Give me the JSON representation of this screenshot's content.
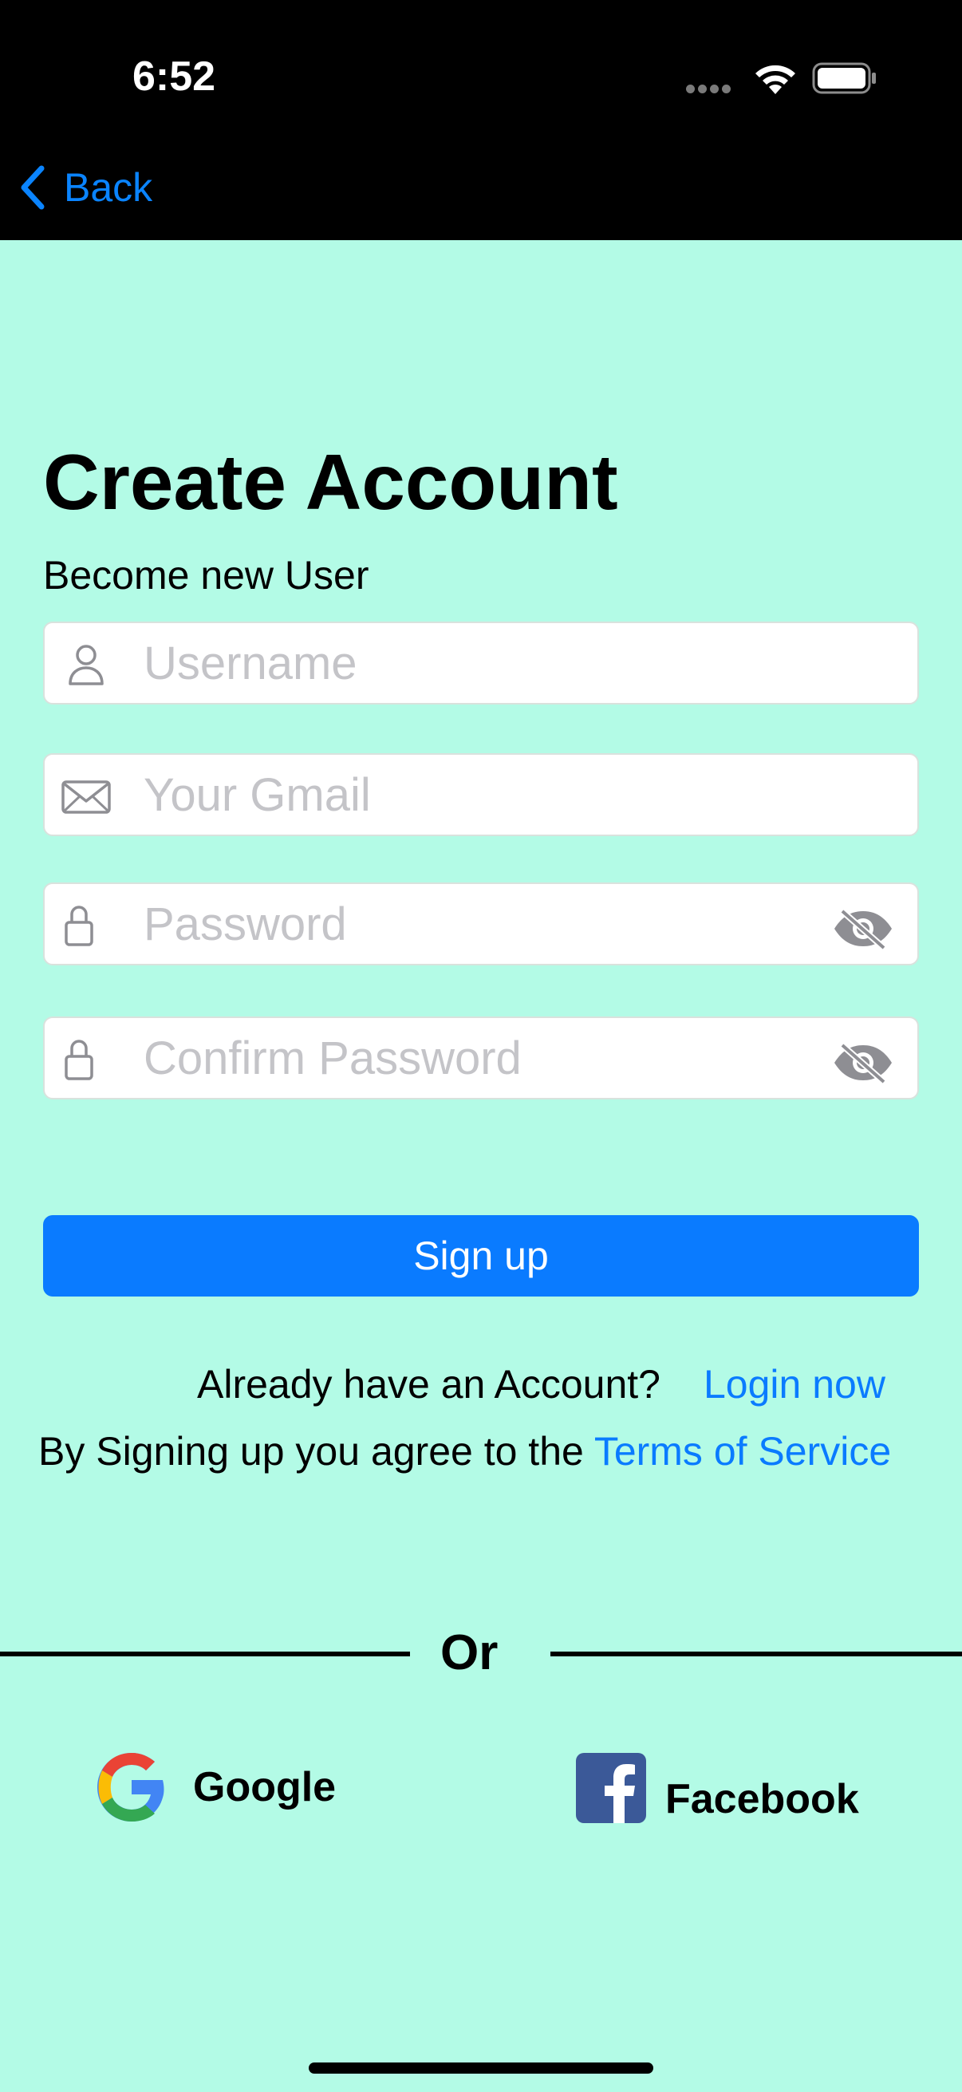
{
  "status_bar": {
    "time": "6:52",
    "icons": [
      "signal-icon",
      "wifi-icon",
      "battery-icon"
    ]
  },
  "nav": {
    "back_label": "Back",
    "back_icon": "chevron-left-icon",
    "accent_color": "#0a84ff"
  },
  "form": {
    "title": "Create Account",
    "subtitle": "Become new User",
    "fields": [
      {
        "placeholder": "Username",
        "value": "",
        "icon": "person-icon"
      },
      {
        "placeholder": "Your Gmail",
        "value": "",
        "icon": "envelope-icon"
      },
      {
        "placeholder": "Password",
        "value": "",
        "icon": "lock-icon",
        "toggle_icon": "eye-slash-icon"
      },
      {
        "placeholder": "Confirm Password",
        "value": "",
        "icon": "lock-icon",
        "toggle_icon": "eye-slash-icon"
      }
    ],
    "submit_label": "Sign up",
    "submit_color": "#0a7bff"
  },
  "links": {
    "already_text": "Already have an Account?",
    "login_label": "Login now",
    "terms_prefix": "By Signing up you agree to the ",
    "terms_label": "Terms of Service"
  },
  "social": {
    "divider_label": "Or",
    "google_label": "Google",
    "facebook_label": "Facebook"
  },
  "theme": {
    "background": "#b3fbe6",
    "header_background": "#000000"
  }
}
